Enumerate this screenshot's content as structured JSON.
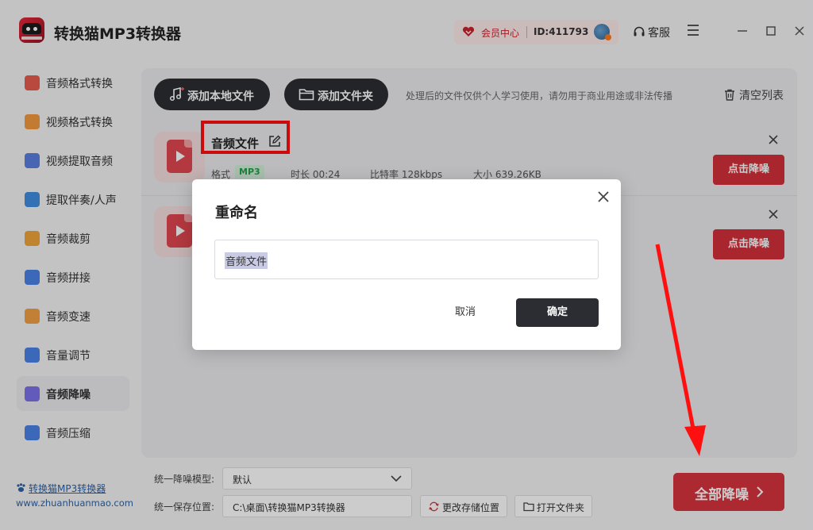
{
  "app": {
    "title": "转换猫MP3转换器"
  },
  "header": {
    "member_center": "会员中心",
    "user_id": "ID:411793",
    "service": "客服"
  },
  "sidebar": {
    "items": [
      {
        "label": "音频格式转换",
        "icon": "audio-convert-icon",
        "color": "#e85a4f"
      },
      {
        "label": "视频格式转换",
        "icon": "video-convert-icon",
        "color": "#f39a3c"
      },
      {
        "label": "视频提取音频",
        "icon": "video-extract-icon",
        "color": "#5b7fe0"
      },
      {
        "label": "提取伴奏/人声",
        "icon": "vocal-extract-icon",
        "color": "#3f8ee0"
      },
      {
        "label": "音频裁剪",
        "icon": "audio-cut-icon",
        "color": "#f0a63a"
      },
      {
        "label": "音频拼接",
        "icon": "audio-join-icon",
        "color": "#4a83e6"
      },
      {
        "label": "音频变速",
        "icon": "speed-icon",
        "color": "#f2a043"
      },
      {
        "label": "音量调节",
        "icon": "volume-icon",
        "color": "#4a83e6"
      },
      {
        "label": "音频降噪",
        "icon": "denoise-icon",
        "color": "#7b72e8"
      },
      {
        "label": "音频压缩",
        "icon": "compress-icon",
        "color": "#4a83e6"
      }
    ],
    "active_index": 8,
    "site_name": "转换猫MP3转换器",
    "site_url": "www.zhuanhuanmao.com"
  },
  "toolbar": {
    "add_file": "添加本地文件",
    "add_folder": "添加文件夹",
    "notice": "处理后的文件仅供个人学习使用，请勿用于商业用途或非法传播",
    "clear_list": "清空列表"
  },
  "files": [
    {
      "name": "音频文件",
      "format_label": "格式",
      "format": "MP3",
      "duration": "时长  00:24",
      "bitrate": "比特率  128kbps",
      "size": "大小  639.26KB",
      "action": "点击降噪"
    },
    {
      "action": "点击降噪"
    }
  ],
  "bottom": {
    "model_label": "统一降噪模型:",
    "model_value": "默认",
    "save_label": "统一保存位置:",
    "save_path": "C:\\桌面\\转换猫MP3转换器",
    "change_location": "更改存储位置",
    "open_folder": "打开文件夹",
    "all_denoise": "全部降噪"
  },
  "modal": {
    "title": "重命名",
    "input_value": "音频文件",
    "cancel": "取消",
    "confirm": "确定"
  },
  "colors": {
    "accent": "#d9343f",
    "dark_button": "#2b2d33",
    "annotation": "#ff1010"
  }
}
